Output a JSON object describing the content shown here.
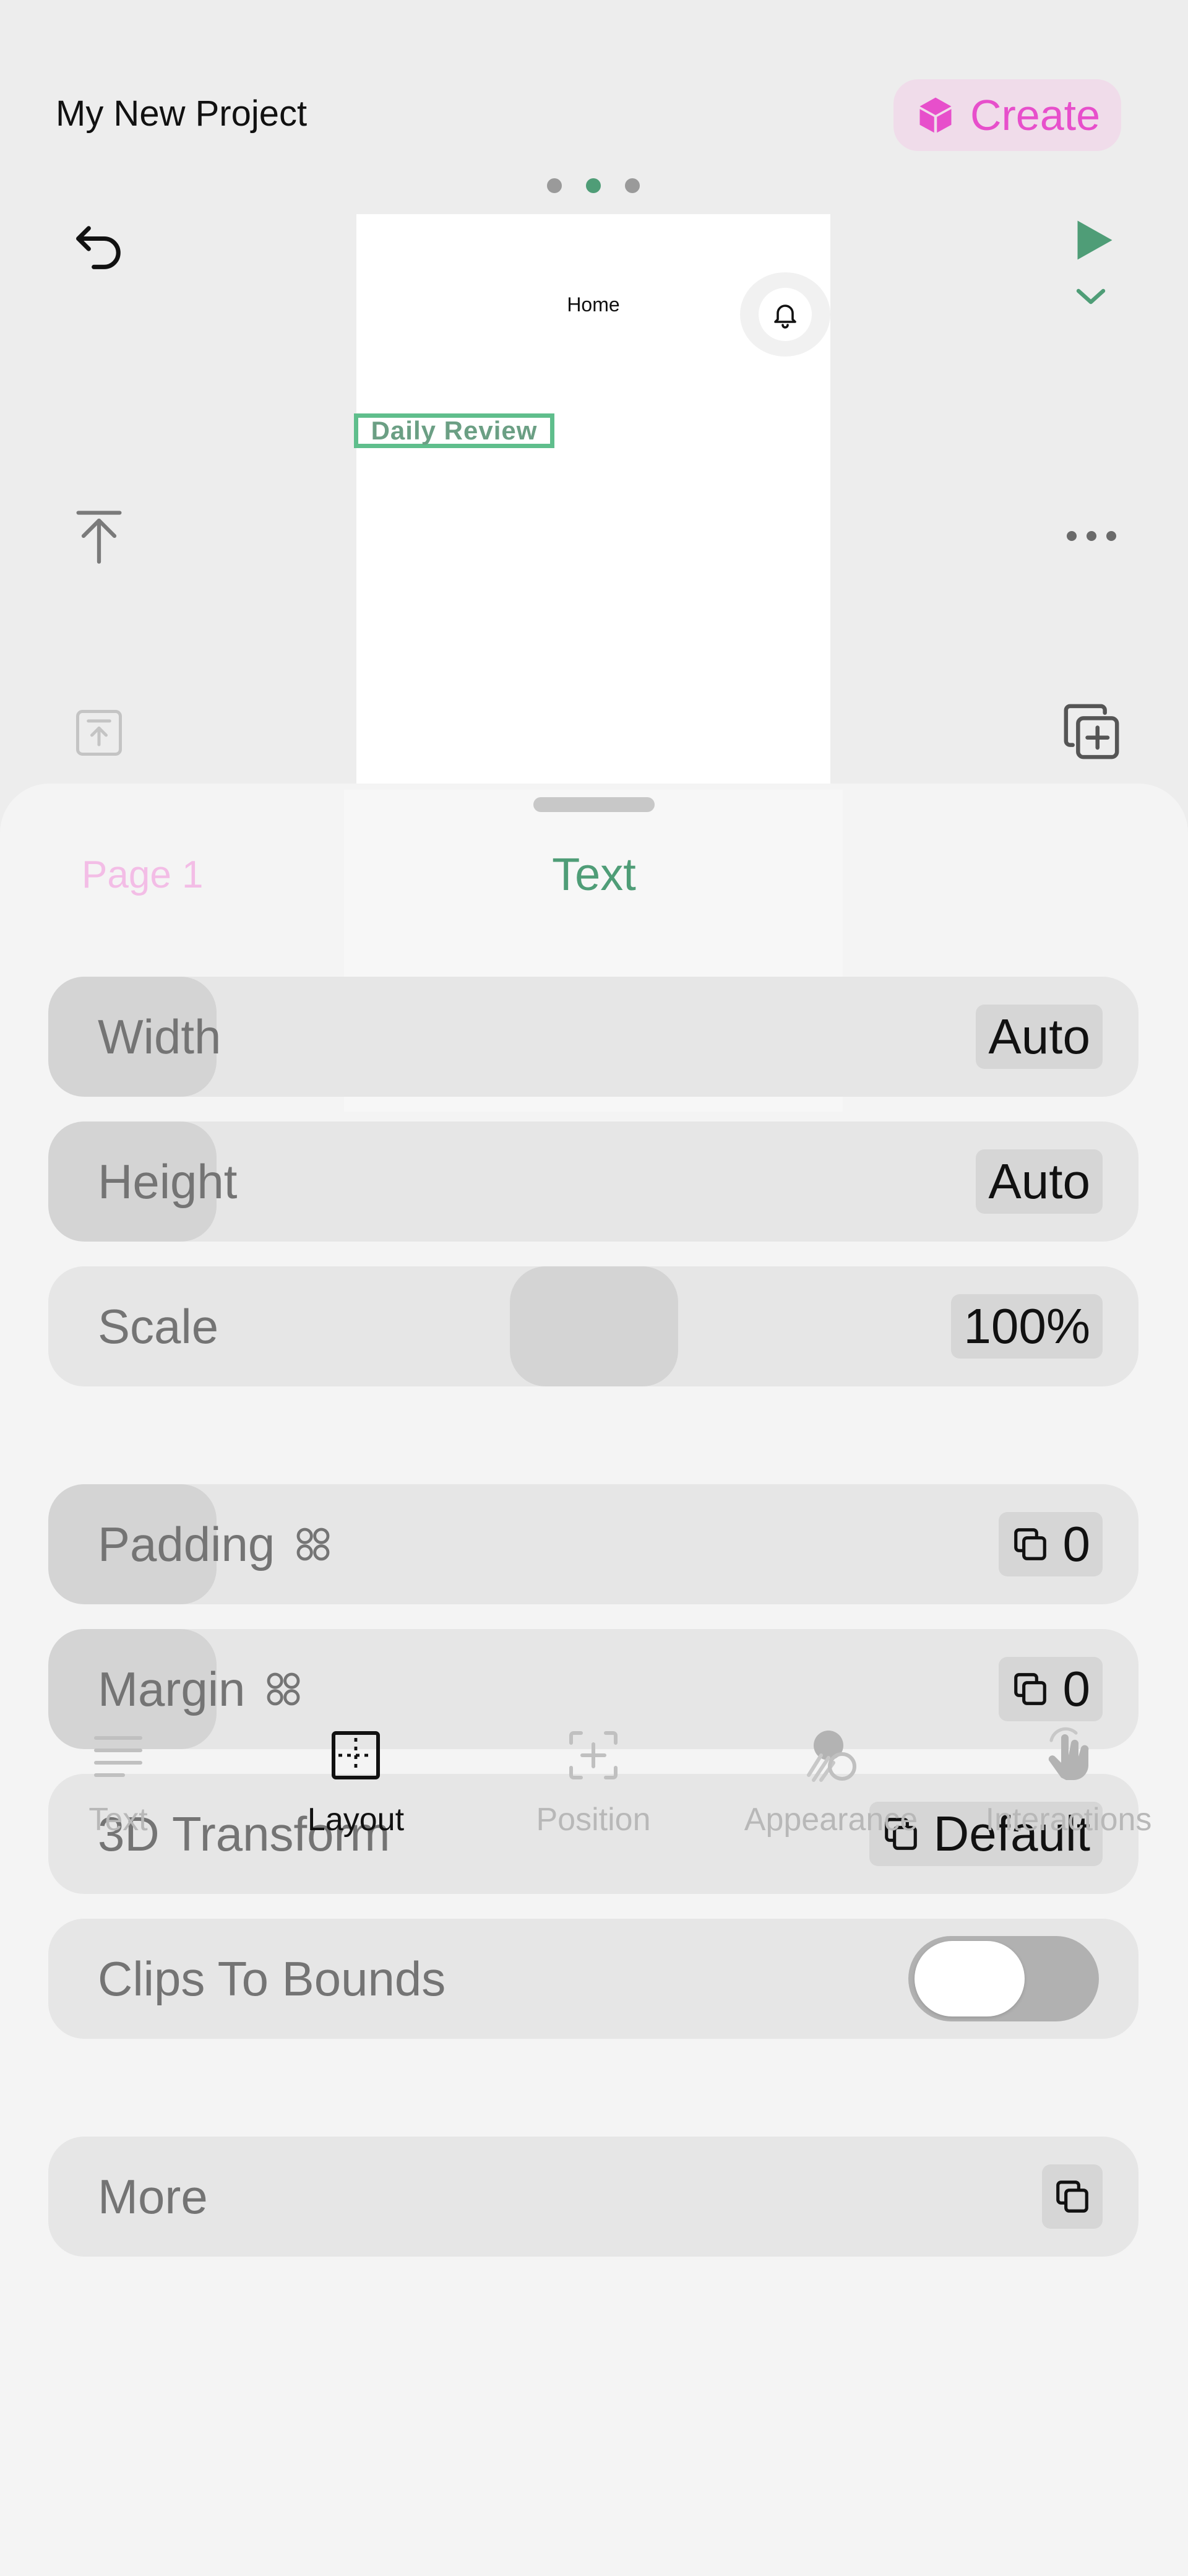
{
  "header": {
    "project_title": "My New Project",
    "create_label": "Create"
  },
  "colors": {
    "accent_green": "#4f9d77",
    "create_pink": "#e74fcb",
    "selection_green": "#5fbe8c"
  },
  "canvas": {
    "home_label": "Home",
    "selected_text": "Daily Review"
  },
  "sheet": {
    "page_label": "Page 1",
    "title": "Text",
    "rows": {
      "width": {
        "label": "Width",
        "value": "Auto"
      },
      "height": {
        "label": "Height",
        "value": "Auto"
      },
      "scale": {
        "label": "Scale",
        "value": "100%"
      },
      "padding": {
        "label": "Padding",
        "value": "0"
      },
      "margin": {
        "label": "Margin",
        "value": "0"
      },
      "transform": {
        "label": "3D Transform",
        "value": "Default"
      },
      "clips": {
        "label": "Clips To Bounds",
        "on": false
      },
      "more": {
        "label": "More"
      }
    }
  },
  "tabs": [
    {
      "label": "Text",
      "icon": "text-lines-icon"
    },
    {
      "label": "Layout",
      "icon": "layout-grid-icon",
      "active": true
    },
    {
      "label": "Position",
      "icon": "position-plus-icon"
    },
    {
      "label": "Appearance",
      "icon": "appearance-icon"
    },
    {
      "label": "Interactions",
      "icon": "touch-hand-icon"
    }
  ]
}
